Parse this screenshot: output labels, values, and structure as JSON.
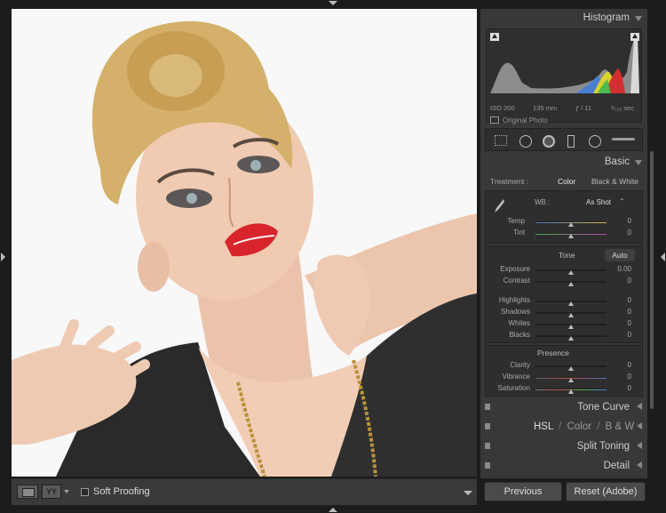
{
  "histogram": {
    "title": "Histogram",
    "iso": "ISO 200",
    "focal": "135 mm",
    "aperture": "ƒ / 11",
    "shutter": "¹⁄₁₂₅ sec",
    "original_photo": "Original Photo"
  },
  "basic": {
    "title": "Basic",
    "treatment_label": "Treatment :",
    "treatment_color": "Color",
    "treatment_bw": "Black & White",
    "wb_label": "WB :",
    "wb_value": "As Shot",
    "temp": {
      "label": "Temp",
      "value": "0"
    },
    "tint": {
      "label": "Tint",
      "value": "0"
    },
    "tone_label": "Tone",
    "auto_label": "Auto",
    "exposure": {
      "label": "Exposure",
      "value": "0.00"
    },
    "contrast": {
      "label": "Contrast",
      "value": "0"
    },
    "highlights": {
      "label": "Highlights",
      "value": "0"
    },
    "shadows": {
      "label": "Shadows",
      "value": "0"
    },
    "whites": {
      "label": "Whites",
      "value": "0"
    },
    "blacks": {
      "label": "Blacks",
      "value": "0"
    },
    "presence_label": "Presence",
    "clarity": {
      "label": "Clarity",
      "value": "0"
    },
    "vibrance": {
      "label": "Vibrance",
      "value": "0"
    },
    "saturation": {
      "label": "Saturation",
      "value": "0"
    }
  },
  "panels": {
    "tone_curve": "Tone Curve",
    "hsl": "HSL",
    "sep1": "/",
    "color": "Color",
    "sep2": "/",
    "bw": "B & W",
    "split_toning": "Split Toning",
    "detail": "Detail"
  },
  "toolbar": {
    "compare_icon": "YY",
    "soft_proofing": "Soft Proofing"
  },
  "buttons": {
    "previous": "Previous",
    "reset": "Reset (Adobe)"
  },
  "colors": {
    "panel_bg": "#383838",
    "app_bg": "#1c1c1c",
    "lips": "#d8242c",
    "hair": "#d4b06a"
  }
}
